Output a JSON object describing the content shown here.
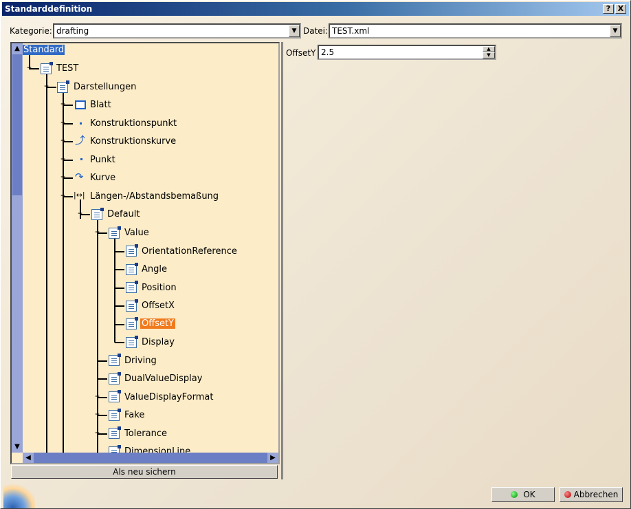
{
  "window": {
    "title": "Standarddefinition",
    "help_btn": "?",
    "close_btn": "X"
  },
  "toolbar": {
    "kategorie_label": "Kategorie:",
    "kategorie_value": "drafting",
    "datei_label": "Datei:",
    "datei_value": "TEST.xml"
  },
  "tree": {
    "root": "Standard",
    "nodes": [
      {
        "label": "TEST"
      },
      {
        "label": "Darstellungen"
      },
      {
        "label": "Blatt"
      },
      {
        "label": "Konstruktionspunkt"
      },
      {
        "label": "Konstruktionskurve"
      },
      {
        "label": "Punkt"
      },
      {
        "label": "Kurve"
      },
      {
        "label": "Längen-/Abstandsbemaßung"
      },
      {
        "label": "Default"
      },
      {
        "label": "Value"
      },
      {
        "label": "OrientationReference"
      },
      {
        "label": "Angle"
      },
      {
        "label": "Position"
      },
      {
        "label": "OffsetX"
      },
      {
        "label": "OffsetY"
      },
      {
        "label": "Display"
      },
      {
        "label": "Driving"
      },
      {
        "label": "DualValueDisplay"
      },
      {
        "label": "ValueDisplayFormat"
      },
      {
        "label": "Fake"
      },
      {
        "label": "Tolerance"
      },
      {
        "label": "DimensionLine"
      }
    ],
    "selected": "OffsetY"
  },
  "save_as_new_label": "Als neu sichern",
  "property": {
    "label": "OffsetY",
    "value": "2.5"
  },
  "buttons": {
    "ok": "OK",
    "cancel": "Abbrechen"
  },
  "colors": {
    "tree_bg": "#fcecc8",
    "selection_orange": "#f07b1e",
    "selection_blue": "#316ac5",
    "title_bar": "#0a246a"
  }
}
